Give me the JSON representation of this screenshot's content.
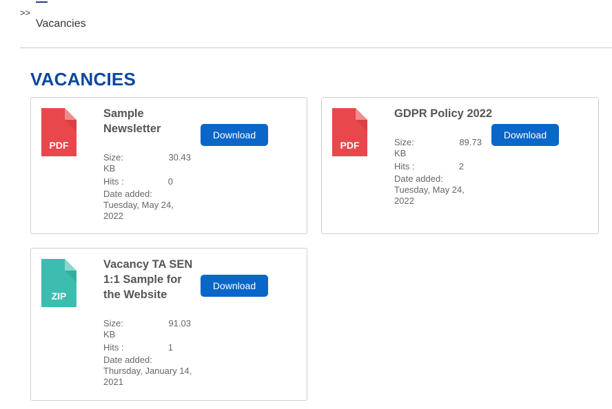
{
  "breadcrumb": {
    "separator": ">>",
    "current": "Vacancies"
  },
  "page": {
    "title": "VACANCIES"
  },
  "files": [
    {
      "title": "Sample Newsletter",
      "type": "PDF",
      "icon": "pdf-icon",
      "color": "#e8474b",
      "download_label": "Download",
      "size_label": "Size:",
      "size_value": "30.43",
      "size_unit": "KB",
      "hits_label": "Hits :",
      "hits_value": "0",
      "date_label": "Date added:",
      "date_value": "Tuesday, May 24, 2022"
    },
    {
      "title": "GDPR Policy 2022",
      "type": "PDF",
      "icon": "pdf-icon",
      "color": "#e8474b",
      "download_label": "Download",
      "size_label": "Size:",
      "size_value": "89.73",
      "size_unit": "KB",
      "hits_label": "Hits :",
      "hits_value": "2",
      "date_label": "Date added:",
      "date_value": "Tuesday, May 24, 2022"
    },
    {
      "title": "Vacancy TA SEN 1:1 Sample for the Website",
      "type": "ZIP",
      "icon": "zip-icon",
      "color": "#3dbdaf",
      "download_label": "Download",
      "size_label": "Size:",
      "size_value": "91.03",
      "size_unit": "KB",
      "hits_label": "Hits :",
      "hits_value": "1",
      "date_label": "Date added:",
      "date_value": "Thursday, January 14, 2021"
    }
  ],
  "colors": {
    "accent": "#0a47a1",
    "button": "#0a66c8",
    "pdf": "#e8474b",
    "zip": "#3dbdaf"
  }
}
